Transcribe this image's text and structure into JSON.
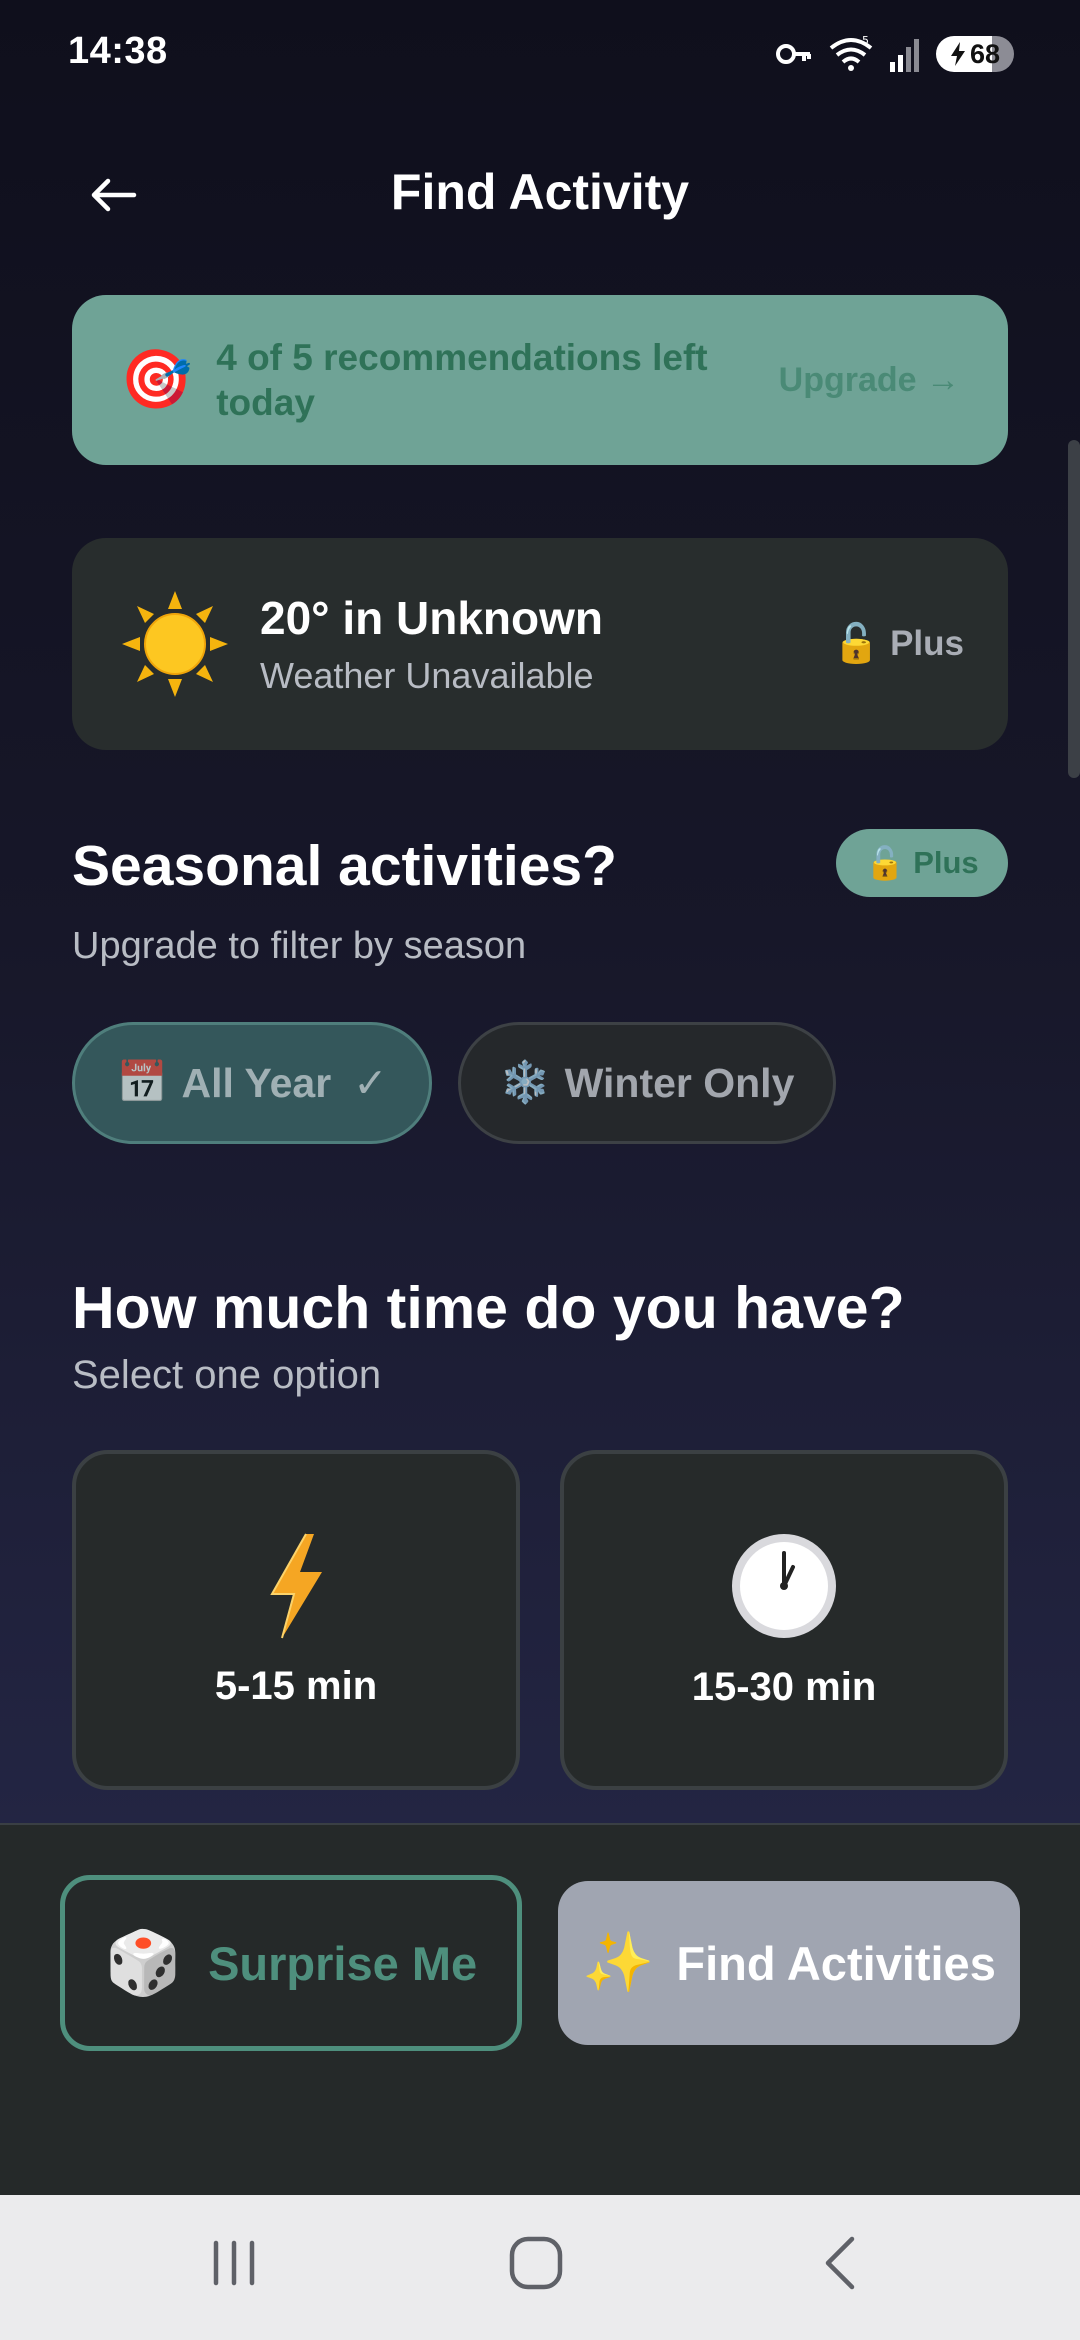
{
  "status_bar": {
    "time": "14:38",
    "battery": "68",
    "icons": [
      "vpn-key-icon",
      "wifi-icon",
      "signal-icon",
      "battery-charging-icon"
    ]
  },
  "header": {
    "title": "Find Activity",
    "back_icon": "back-arrow-icon"
  },
  "rec_banner": {
    "icon": "🎯",
    "text": "4 of 5 recommendations left today",
    "upgrade_label": "Upgrade →"
  },
  "weather": {
    "icon": "☀️",
    "temperature_text": "20° in Unknown",
    "status": "Weather Unavailable",
    "lock_icon": "🔓",
    "plus_label": "Plus"
  },
  "seasonal": {
    "title": "Seasonal activities?",
    "badge_icon": "🔓",
    "badge_label": "Plus",
    "subtitle": "Upgrade to filter by season",
    "options": [
      {
        "icon": "📅",
        "label": "All Year",
        "check": "✓",
        "selected": true
      },
      {
        "icon": "❄️",
        "label": "Winter Only",
        "selected": false
      }
    ]
  },
  "time": {
    "title": "How much time do you have?",
    "subtitle": "Select one option",
    "options": [
      {
        "icon": "⚡",
        "label": "5-15 min"
      },
      {
        "icon": "🕐",
        "label": "15-30 min"
      }
    ]
  },
  "actions": {
    "surprise_icon": "🎲",
    "surprise_label": "Surprise Me",
    "find_icon": "✨",
    "find_label": "Find Activities"
  },
  "system_nav": {
    "items": [
      "recent-apps-icon",
      "home-icon",
      "back-icon"
    ]
  },
  "colors": {
    "accent_green": "#6fa396",
    "accent_green_text": "#2f7258",
    "card_bg": "#282d2d",
    "find_button_bg": "#a0a5b1"
  }
}
